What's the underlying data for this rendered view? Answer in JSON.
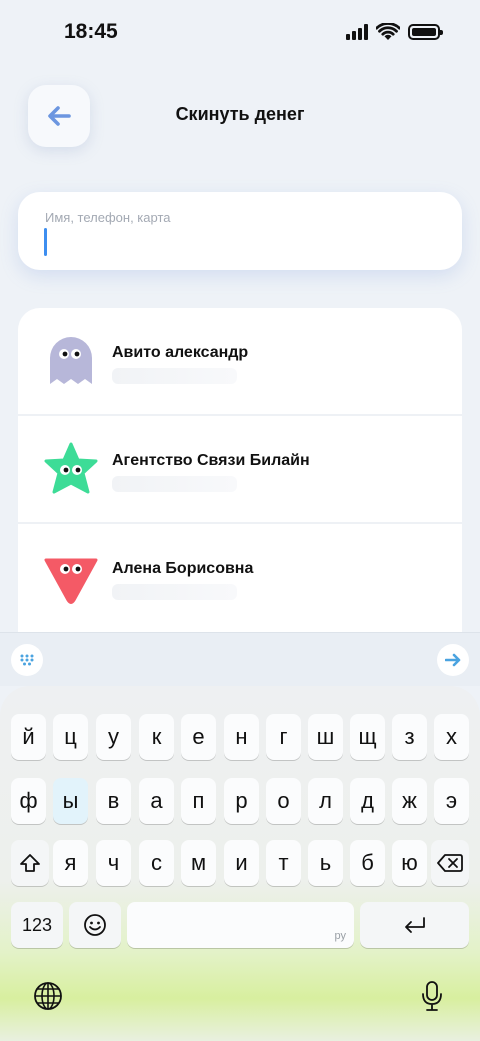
{
  "status_bar": {
    "time": "18:45"
  },
  "header": {
    "title": "Скинуть денег"
  },
  "search": {
    "placeholder": "Имя, телефон, карта"
  },
  "contacts": [
    {
      "name": "Авито александр",
      "avatar": "ghost-avatar-icon",
      "color": "#b7b7d9"
    },
    {
      "name": "Агентство Связи Билайн",
      "avatar": "star-avatar-icon",
      "color": "#3ddc97"
    },
    {
      "name": "Алена Борисовна",
      "avatar": "triangle-avatar-icon",
      "color": "#f45a66"
    }
  ],
  "keyboard": {
    "row1": [
      "й",
      "ц",
      "у",
      "к",
      "е",
      "н",
      "г",
      "ш",
      "щ",
      "з",
      "х"
    ],
    "row2": [
      "ф",
      "ы",
      "в",
      "а",
      "п",
      "р",
      "о",
      "л",
      "д",
      "ж",
      "э"
    ],
    "row3": [
      "я",
      "ч",
      "с",
      "м",
      "и",
      "т",
      "ь",
      "б",
      "ю"
    ],
    "numbers_label": "123",
    "space_label": "ру",
    "colors": {
      "accent": "#3d8ef0",
      "back_arrow": "#6c96e0",
      "send_arrow": "#4aa3e0"
    }
  }
}
